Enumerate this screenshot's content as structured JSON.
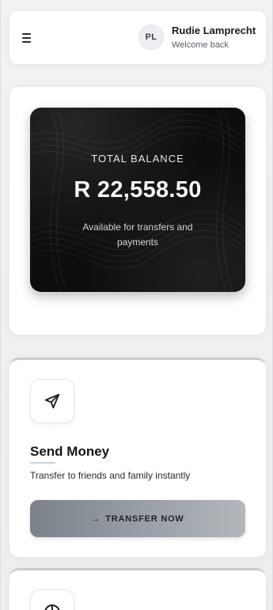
{
  "header": {
    "avatar_initials": "PL",
    "user_name": "Rudie Lamprecht",
    "user_subtitle": "Welcome back"
  },
  "balance": {
    "label": "TOTAL BALANCE",
    "amount": "R 22,558.50",
    "note": "Available for transfers and payments"
  },
  "send_money": {
    "title": "Send Money",
    "description": "Transfer to friends and family instantly",
    "button_arrow": "→",
    "button_label": "TRANSFER NOW"
  },
  "icons": {
    "menu": "hamburger-menu-icon",
    "send": "paper-plane-icon",
    "next_card": "compass-icon"
  },
  "colors": {
    "card_dark": "#0d0d0d",
    "button_start": "#7c828a",
    "button_end": "#b3b7bc",
    "accent_underline": "#c7d1db"
  }
}
